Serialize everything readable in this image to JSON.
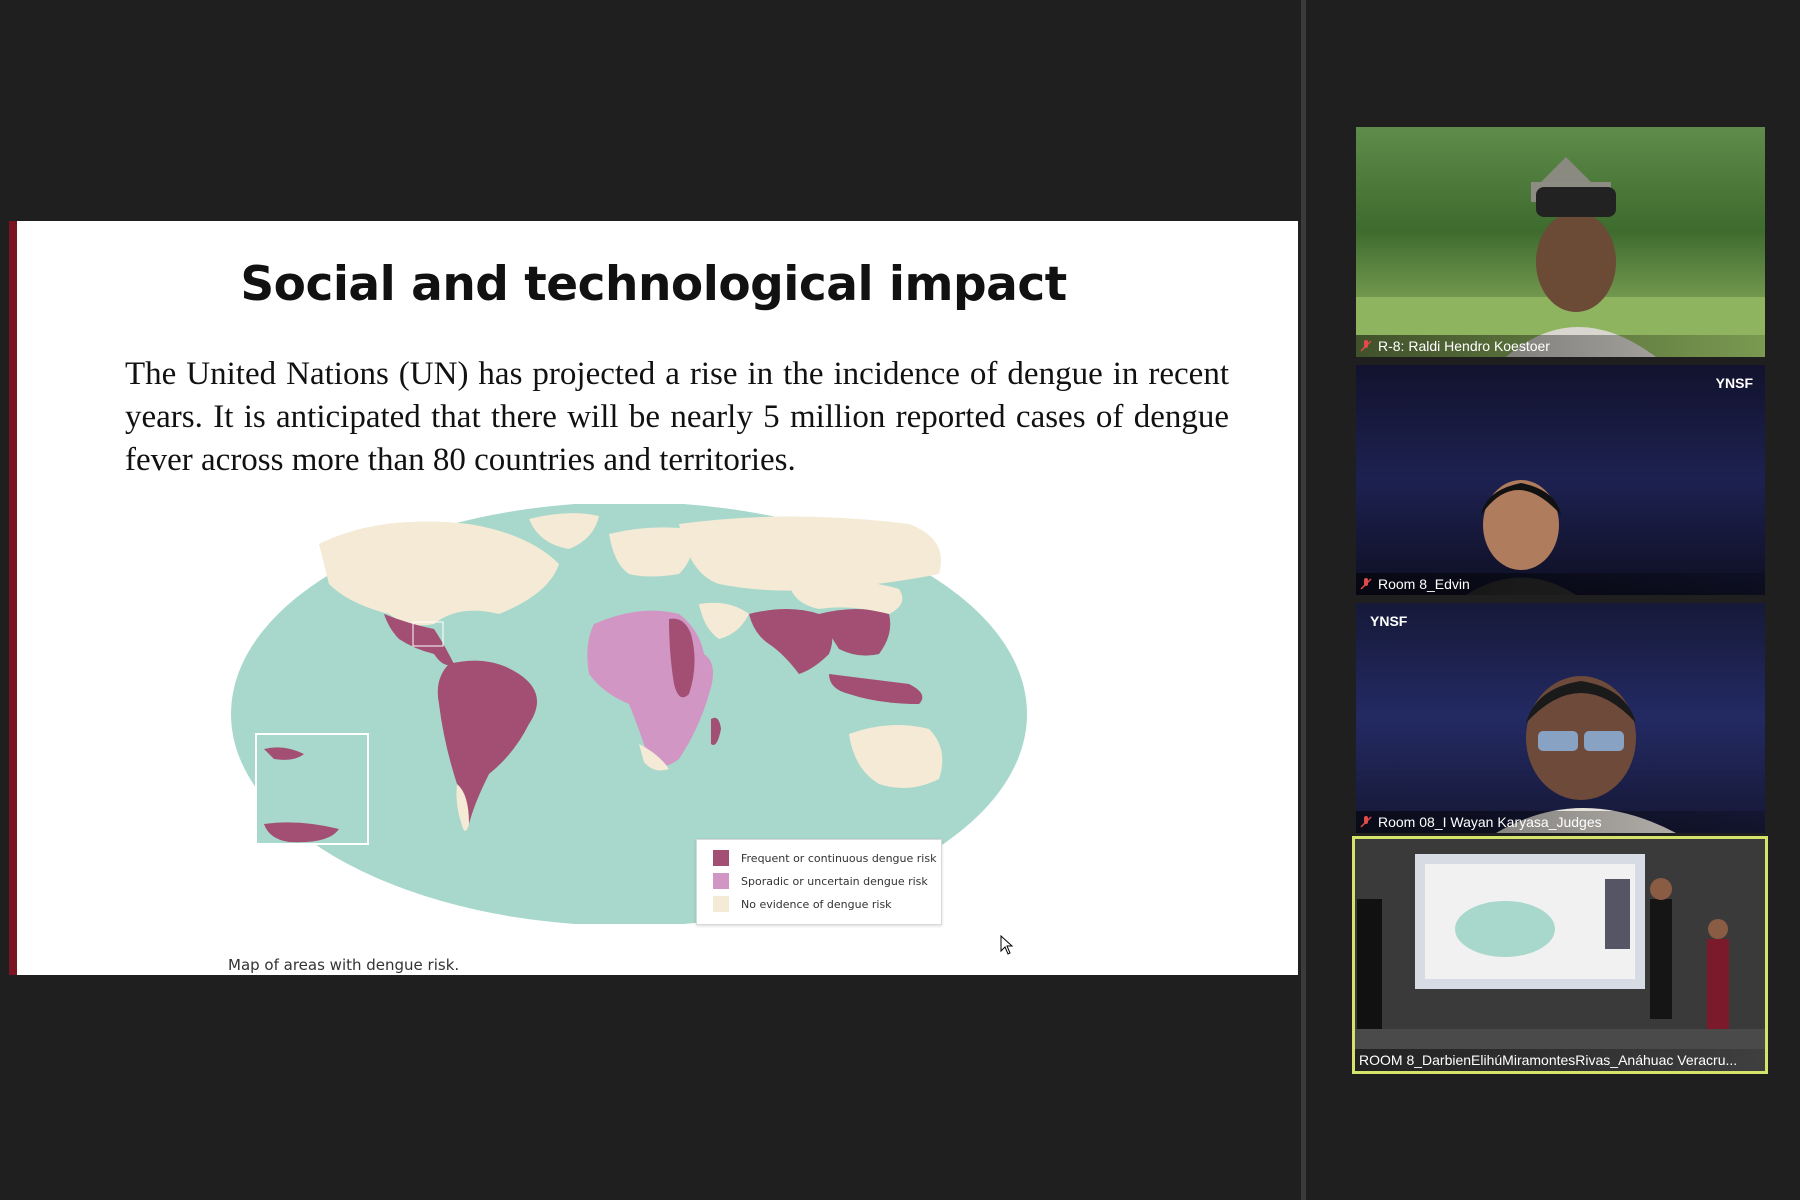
{
  "slide": {
    "title": "Social and technological impact",
    "body": "The United Nations (UN) has projected a rise in the incidence of dengue in recent years. It is anticipated that there will be nearly 5 million reported cases of dengue fever across more than 80 countries and territories.",
    "legend": [
      {
        "label": "Frequent or continuous dengue risk",
        "color": "#a24f73"
      },
      {
        "label": "Sporadic or uncertain dengue risk",
        "color": "#d296c4"
      },
      {
        "label": "No evidence of dengue risk",
        "color": "#f4ead6"
      }
    ],
    "caption": "Map of areas with dengue risk.",
    "colors": {
      "ocean": "#a8d8cb",
      "frequent": "#a24f73",
      "sporadic": "#d296c4",
      "none": "#f4ead6"
    }
  },
  "participants": [
    {
      "name": "R-8: Raldi Hendro Koestoer"
    },
    {
      "name": "Room 8_Edvin",
      "logos_left": "",
      "logos_right": "YNSF"
    },
    {
      "name": "Room 08_I Wayan Karyasa_Judges",
      "logos_left": "YNSF",
      "logos_right": ""
    },
    {
      "name": "ROOM 8_DarbienElihúMiramontesRivas_Anáhuac Veracru..."
    }
  ]
}
